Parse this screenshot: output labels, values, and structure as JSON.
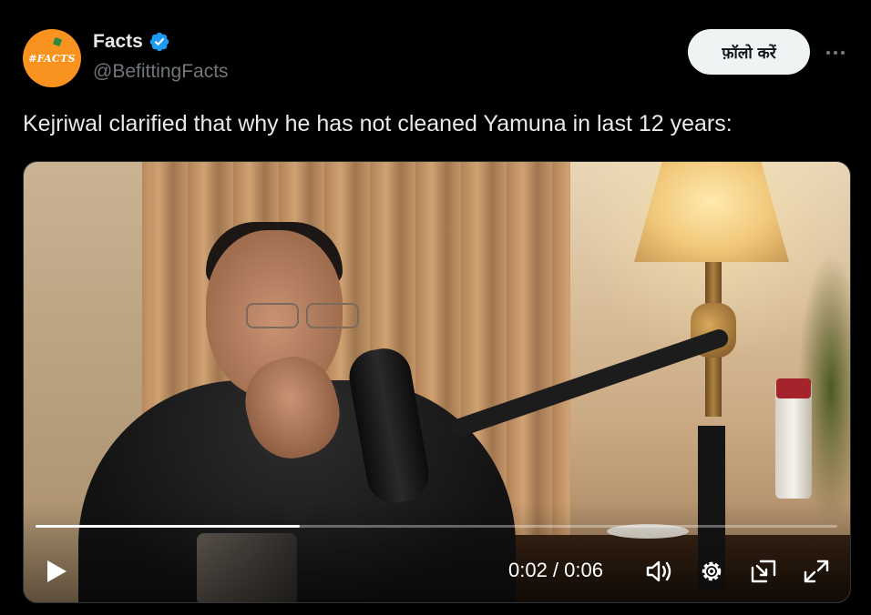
{
  "author": {
    "display_name": "Facts",
    "handle": "@BefittingFacts",
    "avatar_text": "#FACTS",
    "verified": true,
    "avatar_color": "#f7931e",
    "verified_color": "#1d9bf0"
  },
  "actions": {
    "follow_label": "फ़ॉलो करें",
    "more_icon": "more-horizontal-icon"
  },
  "tweet": {
    "text": "Kejriwal clarified that why he has not cleaned Yamuna in last 12 years:"
  },
  "video": {
    "current_time": "0:02",
    "duration": "0:06",
    "time_display": "0:02 / 0:06",
    "progress": 0.33,
    "icons": [
      "play-icon",
      "volume-icon",
      "settings-icon",
      "picture-in-picture-icon",
      "fullscreen-icon"
    ]
  },
  "colors": {
    "background": "#000000",
    "text_primary": "#e7e9ea",
    "text_secondary": "#71767b",
    "follow_button_bg": "#eff3f4"
  }
}
